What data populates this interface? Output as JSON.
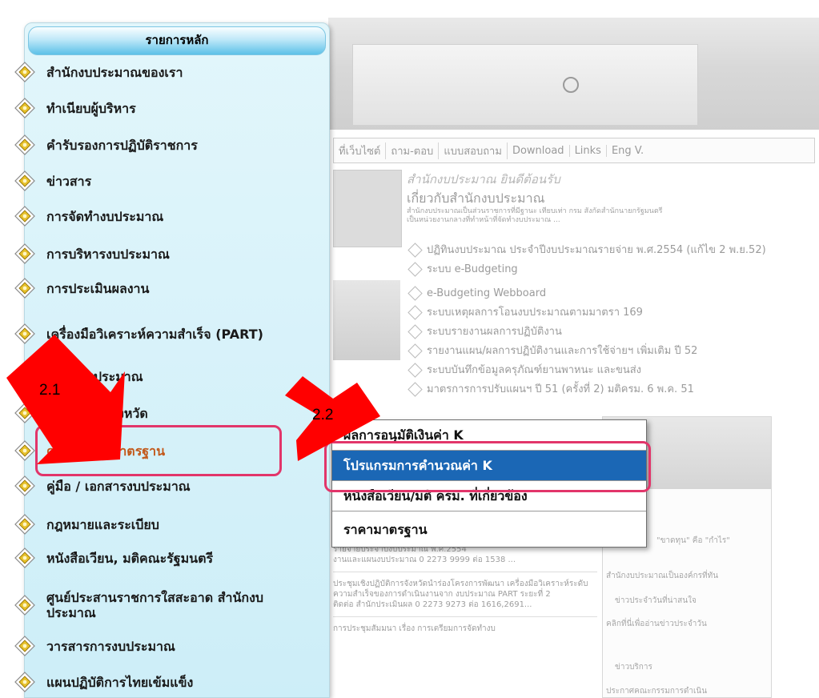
{
  "menu": {
    "header": "รายการหลัก",
    "items": [
      {
        "label": "สำนักงบประมาณของเรา"
      },
      {
        "label": "ทำเนียบผู้บริหาร"
      },
      {
        "label": "คำรับรองการปฏิบัติราชการ"
      },
      {
        "label": "ข่าวสาร"
      },
      {
        "label": "การจัดทำงบประมาณ"
      },
      {
        "label": "การบริหารงบประมาณ"
      },
      {
        "label": "การประเมินผลงาน"
      },
      {
        "label": "เครื่องมือวิเคราะห์ความสำเร็จ (PART)"
      },
      {
        "label": "ข้อมูลงบประมาณ"
      },
      {
        "label": "งบประมาณจังหวัด"
      },
      {
        "label": "ค่า K/ราคามาตรฐาน"
      },
      {
        "label": "คู่มือ / เอกสารงบประมาณ"
      },
      {
        "label": "กฎหมายและระเบียบ"
      },
      {
        "label": "หนังสือเวียน, มติคณะรัฐมนตรี"
      },
      {
        "label": "ศูนย์ประสานราชการใสสะอาด สำนักงบประมาณ"
      },
      {
        "label": "วารสารการงบประมาณ"
      },
      {
        "label": "แผนปฏิบัติการไทยเข้มแข็ง"
      }
    ]
  },
  "submenu": {
    "items": [
      {
        "label": "ผลการอนุมัติเงินค่า K"
      },
      {
        "label": "โปรแกรมการคำนวณค่า K"
      },
      {
        "label": "หนังสือเวียน/มติ ครม. ที่เกี่ยวข้อง"
      },
      {
        "label": "ราคามาตรฐาน"
      }
    ]
  },
  "annotations": {
    "step1": "2.1",
    "step2": "2.2",
    "arrow_color": "#ff0000",
    "highlight_color": "#e2356a"
  },
  "background": {
    "nav": [
      "ที่เว็บไซต์",
      "ถาม-ตอบ",
      "แบบสอบถาม",
      "Download",
      "Links",
      "Eng V."
    ],
    "welcome": "สำนักงบประมาณ ยินดีต้อนรับ",
    "about_title": "เกี่ยวกับสำนักงบประมาณ",
    "about_text": "สำนักงบประมาณเป็นส่วนราชการที่มีฐานะ เทียบเท่า กรม สังกัดสำนักนายกรัฐมนตรีเป็นหน่วยงานกลางที่ทำหน้าที่จัดทำงบประมาณ ...",
    "news": [
      "ปฏิทินงบประมาณ ประจำปีงบประมาณรายจ่าย พ.ศ.2554 (แก้ไข 2 พ.ย.52)",
      "ระบบ e-Budgeting",
      "e-Budgeting Webboard",
      "ระบบเหตุผลการโอนงบประมาณตามมาตรา 169",
      "ระบบรายงานผลการปฏิบัติงาน",
      "รายงานแผน/ผลการปฏิบัติงานและการใช้จ่ายฯ เพิ่มเติม ปี 52",
      "ระบบบันทึกข้อมูลครุภัณฑ์ยานพาหนะ และขนส่ง",
      "มาตรการการปรับแผนฯ ปี 51 (ครั้งที่ 2) มติครม. 6 พ.ค. 51"
    ],
    "lower_1": "รายจ่ายประจำปีงบประมาณ พ.ศ.2554",
    "lower_1b": "งานและแผนงบประมาณ 0 2273 9999 ต่อ 1538 ...",
    "lower_2": "ประชุมเชิงปฏิบัติการจังหวัดนำร่องโครงการพัฒนา เครื่องมือวิเคราะห์ระดับความสำเร็จของการดำเนินงานจาก งบประมาณ PART ระยะที่ 2",
    "lower_2b": "ติดต่อ สำนักประเมินผล 0 2273 9273 ต่อ 1616,2691...",
    "lower_3": "การประชุมสัมมนา เรื่อง การเตรียมการจัดทำงบ",
    "right_1": "สำนักงบประมาณเป็นองค์กรที่ทัน",
    "right_2": "ข่าวประจำวันที่น่าสนใจ",
    "right_3": "คลิกที่นี่เพื่ออ่านข่าวประจำวัน",
    "right_4": "ข่าวบริการ",
    "right_5": "ประกาศคณะกรรมการดำเนิน",
    "right_6": "\"ขาดทุน\" คือ \"กำไร\""
  }
}
